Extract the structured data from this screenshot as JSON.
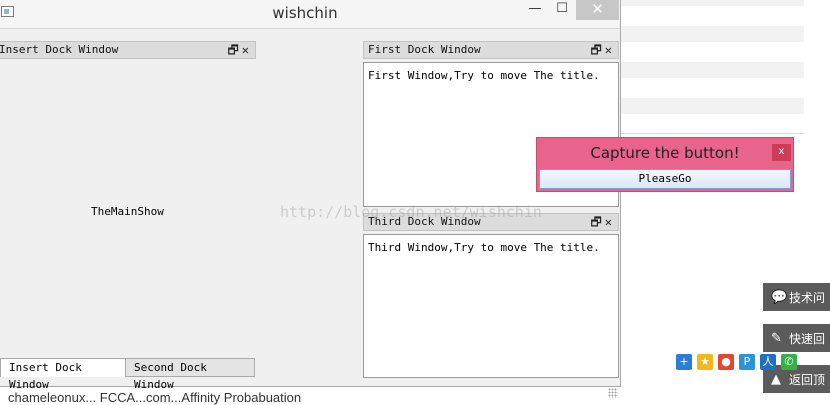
{
  "window": {
    "title": "wishchin",
    "minimize_glyph": "—",
    "maximize_glyph": "☐",
    "close_glyph": "✕"
  },
  "docks": {
    "insert": {
      "title": "Insert Dock Window"
    },
    "first": {
      "title": "First Dock Window",
      "content": "First Window,Try to move The title."
    },
    "third": {
      "title": "Third Dock Window",
      "content": "Third Window,Try to move The title."
    },
    "float_glyph": "🗗",
    "close_glyph": "✕"
  },
  "central": {
    "label": "TheMainShow"
  },
  "tabs": [
    "Insert Dock Window",
    "Second Dock Window"
  ],
  "watermark": "http://blog.csdn.net/wishchin",
  "popup": {
    "title": "Capture the button!",
    "close_glyph": "x",
    "button_label": "PleaseGo"
  },
  "background_page": {
    "side_buttons": [
      "技术问",
      "快速回",
      "返回顶"
    ],
    "side_icons": [
      "chat-bubble-icon",
      "pencil-icon",
      "arrow-up-icon"
    ],
    "share_icons": [
      "plus-icon",
      "qzone-icon",
      "weibo-icon",
      "tencent-icon",
      "renren-icon",
      "wechat-icon"
    ],
    "bottom_text": "chameleonux... FCCA...com...Affinity Probabuation"
  },
  "colors": {
    "popup_bg": "#e8648c",
    "popup_close": "#cf3c57",
    "side_button_bg": "#5b5b5b"
  }
}
